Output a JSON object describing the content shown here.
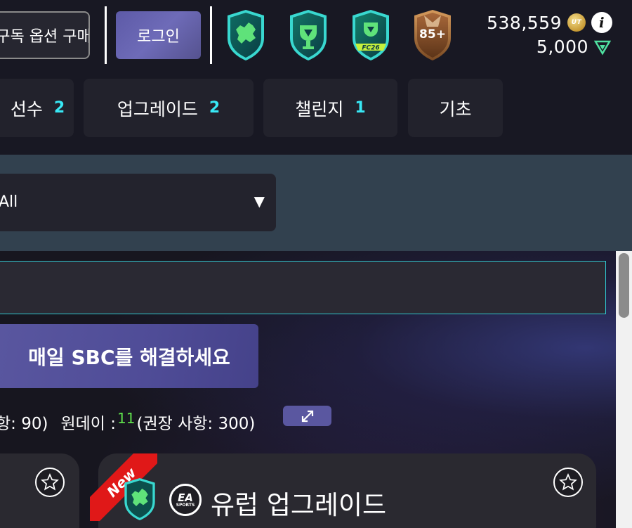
{
  "header": {
    "subscribe_label": "구독 옵션 구매",
    "login_label": "로그인",
    "badges": [
      {
        "icon": "europe-shield-icon"
      },
      {
        "icon": "upgrade-shield-icon"
      },
      {
        "icon": "fc26-shield-icon"
      },
      {
        "icon": "85-plus-pack-icon",
        "text": "85+"
      }
    ],
    "coins": "538,559",
    "coin_symbol": "UT",
    "points": "5,000",
    "info_glyph": "i"
  },
  "tabs": [
    {
      "label": "선수",
      "count": "2"
    },
    {
      "label": "업그레이드",
      "count": "2"
    },
    {
      "label": "챌린지",
      "count": "1"
    },
    {
      "label": "기초",
      "count": ""
    }
  ],
  "filter": {
    "selected": "All",
    "caret": "▼"
  },
  "main": {
    "search_value": "",
    "daily_button": "매일 SBC를 해결하세요",
    "stats": {
      "prefix": "항: 90)",
      "label": "원데이 :",
      "value": "11",
      "suffix": "(권장 사항: 300)"
    },
    "expand_icon": "↗"
  },
  "cards": [
    {
      "title": ""
    },
    {
      "ribbon": "New",
      "title": "유럽 업그레이드",
      "brand": "EA",
      "brand_sub": "SPORTS"
    }
  ],
  "colors": {
    "accent": "#5a57a0",
    "tab_count": "#38e8f5",
    "green_value": "#5fe04c",
    "search_border": "#2fc6cf",
    "ribbon": "#e01818"
  }
}
